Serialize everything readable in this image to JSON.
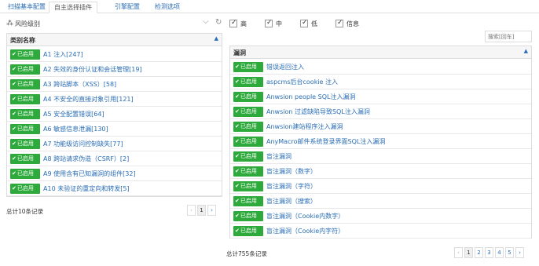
{
  "tabs": [
    "扫描基本配置",
    "自主选择插件",
    "引擎配置",
    "检测选项"
  ],
  "risk": {
    "label": "风险级别",
    "tree_icon": "tree-icon",
    "chevron_icon": "chevron-down-icon",
    "refresh_icon": "refresh-icon"
  },
  "levels": [
    "高",
    "中",
    "低",
    "信息"
  ],
  "search": {
    "placeholder": "搜索[回车]"
  },
  "left": {
    "header": "类别名称",
    "badge": "已启用",
    "items": [
      "A1 注入[247]",
      "A2 失效的身份认证和会话管理[19]",
      "A3 跨站脚本（XSS）[58]",
      "A4 不安全的直接对象引用[121]",
      "A5 安全配置错误[64]",
      "A6 敏感信息泄漏[130]",
      "A7 功能级访问控制缺失[77]",
      "A8 跨站请求伪造（CSRF）[2]",
      "A9 使用含有已知漏洞的组件[32]",
      "A10 未验证的重定向和转发[5]"
    ],
    "total": "总计10条记录",
    "pager": [
      "‹",
      "1",
      "›"
    ]
  },
  "right": {
    "header": "漏洞",
    "badge": "已启用",
    "items": [
      "错误返回注入",
      "aspcms后台cookie 注入",
      "Anwsion people SQL注入漏洞",
      "Anwsion 过滤缺陷导致SQL注入漏洞",
      "Anwsion建站程序注入漏洞",
      "AnyMacro邮件系统登录界面SQL注入漏洞",
      "盲注漏洞",
      "盲注漏洞（数字）",
      "盲注漏洞（字符）",
      "盲注漏洞（搜索）",
      "盲注漏洞（Cookie内数字）",
      "盲注漏洞（Cookie内字符）"
    ],
    "total": "总计755条记录",
    "pager": [
      "‹",
      "1",
      "2",
      "3",
      "4",
      "5",
      "›"
    ]
  }
}
